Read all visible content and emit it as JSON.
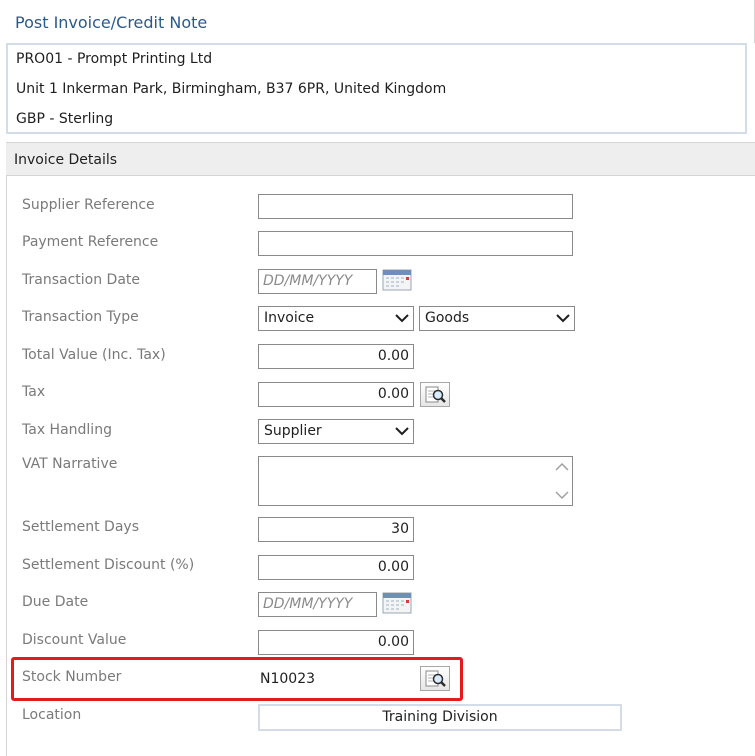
{
  "page": {
    "title": "Post Invoice/Credit Note"
  },
  "supplier": {
    "name_line": "PRO01 - Prompt Printing Ltd",
    "address_line": "Unit 1 Inkerman Park, Birmingham, B37 6PR, United Kingdom",
    "currency_line": "GBP - Sterling"
  },
  "section": {
    "title": "Invoice Details"
  },
  "fields": {
    "supplier_reference": {
      "label": "Supplier Reference",
      "value": ""
    },
    "payment_reference": {
      "label": "Payment Reference",
      "value": ""
    },
    "transaction_date": {
      "label": "Transaction Date",
      "placeholder": "DD/MM/YYYY"
    },
    "transaction_type": {
      "label": "Transaction Type",
      "value": "Invoice",
      "category": "Goods"
    },
    "total_value": {
      "label": "Total Value (Inc. Tax)",
      "value": "0.00"
    },
    "tax": {
      "label": "Tax",
      "value": "0.00"
    },
    "tax_handling": {
      "label": "Tax Handling",
      "value": "Supplier"
    },
    "vat_narrative": {
      "label": "VAT Narrative",
      "value": ""
    },
    "settlement_days": {
      "label": "Settlement Days",
      "value": "30"
    },
    "settlement_discount": {
      "label": "Settlement Discount (%)",
      "value": "0.00"
    },
    "due_date": {
      "label": "Due Date",
      "placeholder": "DD/MM/YYYY"
    },
    "discount_value": {
      "label": "Discount Value",
      "value": "0.00"
    },
    "stock_number": {
      "label": "Stock Number",
      "value": "N10023"
    },
    "location": {
      "label": "Location",
      "value": "Training Division"
    }
  },
  "icons": {
    "lookup": "magnifier-lookup-icon",
    "calendar": "calendar-icon",
    "dropdown": "chevron-down-icon"
  },
  "colors": {
    "title": "#2b5a8a",
    "highlight": "#e31b1b",
    "label": "#7a7a7a"
  }
}
